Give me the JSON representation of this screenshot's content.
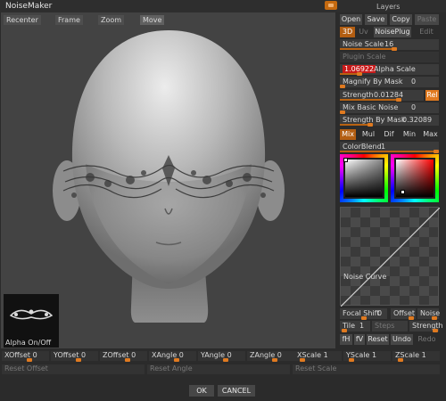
{
  "window": {
    "title": "NoiseMaker",
    "layers_label": "Layers"
  },
  "viewport": {
    "buttons": {
      "recenter": "Recenter",
      "frame": "Frame",
      "zoom": "Zoom",
      "move": "Move"
    },
    "alpha_label": "Alpha On/Off"
  },
  "panel": {
    "file_buttons": {
      "open": "Open",
      "save": "Save",
      "copy": "Copy",
      "paste": "Paste"
    },
    "mode_buttons": {
      "three_d": "3D",
      "uv": "Uv",
      "noiseplug": "NoisePlug",
      "edit": "Edit"
    },
    "noise_scale": {
      "label": "Noise Scale",
      "value": "16",
      "level": 0.55
    },
    "plugin_scale": {
      "label": "Plugin Scale"
    },
    "alpha_scale": {
      "value": "1.06922",
      "label": "Alpha Scale",
      "level": 0.2
    },
    "magnify_by_mask": {
      "label": "Magnify By Mask",
      "value": "0"
    },
    "strength": {
      "label": "Strength",
      "value": "0.01284",
      "level": 0.7
    },
    "rel": "Rel",
    "mix_basic_noise": {
      "label": "Mix Basic Noise",
      "value": "0"
    },
    "strength_by_mask": {
      "label": "Strength By Mask",
      "value": "0.32089"
    },
    "blend_tabs": {
      "mix": "Mix",
      "mul": "Mul",
      "dif": "Dif",
      "min": "Min",
      "max": "Max"
    },
    "color_blend": {
      "label": "ColorBlend",
      "value": "1"
    },
    "noise_curve_label": "Noise Curve",
    "focal_shift": {
      "label": "Focal Shift",
      "value": "0"
    },
    "offset_label": "Offset",
    "noise_label": "Noise",
    "tile": {
      "label": "Tile",
      "value": "1"
    },
    "steps_label": "Steps",
    "strength_label": "Strength",
    "curve_buttons": {
      "fh": "fH",
      "fv": "fV",
      "reset": "Reset",
      "undo": "Undo",
      "redo": "Redo"
    }
  },
  "bottom": {
    "xoffset": {
      "label": "XOffset",
      "value": "0"
    },
    "yoffset": {
      "label": "YOffset",
      "value": "0"
    },
    "zoffset": {
      "label": "ZOffset",
      "value": "0"
    },
    "xangle": {
      "label": "XAngle",
      "value": "0"
    },
    "yangle": {
      "label": "YAngle",
      "value": "0"
    },
    "zangle": {
      "label": "ZAngle",
      "value": "0"
    },
    "xscale": {
      "label": "XScale",
      "value": "1"
    },
    "yscale": {
      "label": "YScale",
      "value": "1"
    },
    "zscale": {
      "label": "ZScale",
      "value": "1"
    },
    "reset_offset": "Reset Offset",
    "reset_angle": "Reset Angle",
    "reset_scale": "Reset Scale",
    "ok": "OK",
    "cancel": "CANCEL"
  },
  "colors": {
    "accent": "#e07a20",
    "accent_dark": "#b35e12",
    "highlight_red": "#c81a1a",
    "panel_bg": "#2b2b2b"
  }
}
